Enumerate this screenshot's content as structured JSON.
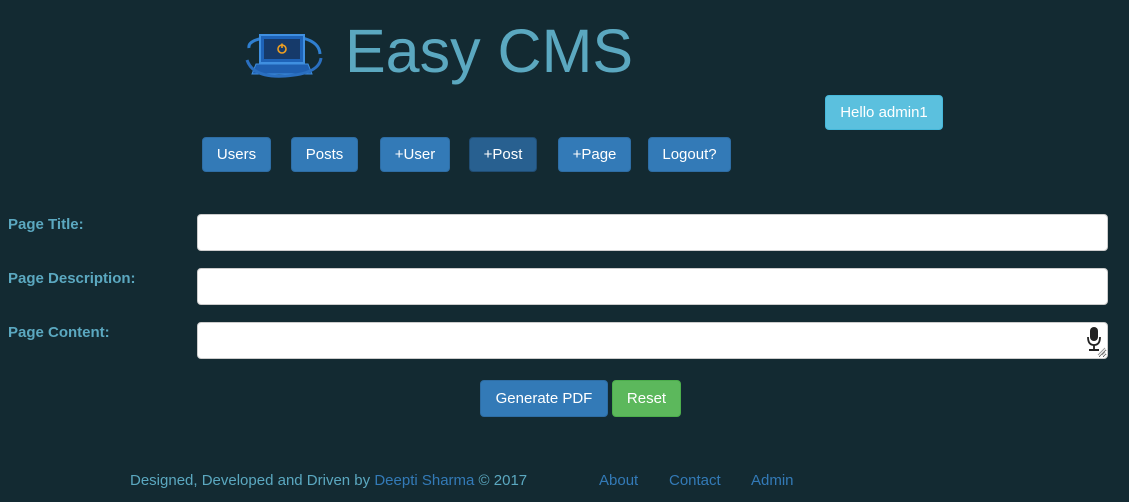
{
  "header": {
    "logo_icon": "laptop-power-logo-icon",
    "title": "Easy CMS",
    "greeting": "Hello admin1"
  },
  "nav": {
    "items": [
      {
        "label": "Users"
      },
      {
        "label": "Posts"
      },
      {
        "label": "+User"
      },
      {
        "label": "+Post"
      },
      {
        "label": "+Page"
      },
      {
        "label": "Logout?"
      }
    ],
    "active": "+Post"
  },
  "form": {
    "fields": [
      {
        "label": "Page Title:",
        "value": "",
        "placeholder": ""
      },
      {
        "label": "Page Description:",
        "value": "",
        "placeholder": ""
      },
      {
        "label": "Page Content:",
        "value": "",
        "placeholder": ""
      }
    ],
    "mic_icon": "microphone-icon",
    "buttons": {
      "generate_pdf": "Generate PDF",
      "reset": "Reset"
    }
  },
  "footer": {
    "credit_prefix": "Designed, Developed and Driven by ",
    "author": "Deepti Sharma",
    "credit_suffix": " © 2017",
    "links": [
      {
        "label": "About"
      },
      {
        "label": "Contact"
      },
      {
        "label": "Admin"
      }
    ]
  },
  "colors": {
    "background": "#132a32",
    "title": "#5ba8c0",
    "primary": "#337ab7",
    "info": "#5bc0de",
    "success": "#5cb85c"
  }
}
